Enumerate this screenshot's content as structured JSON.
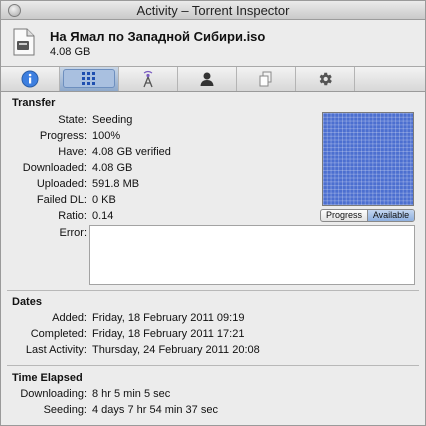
{
  "window": {
    "title": "Activity – Torrent Inspector"
  },
  "torrent": {
    "name": "На Ямал по Западной Сибири.iso",
    "size": "4.08 GB"
  },
  "tabs": [
    {
      "id": "info",
      "icon": "info-icon"
    },
    {
      "id": "activity",
      "icon": "pieces-grid-icon",
      "selected": true
    },
    {
      "id": "trackers",
      "icon": "antenna-icon"
    },
    {
      "id": "peers",
      "icon": "person-icon"
    },
    {
      "id": "files",
      "icon": "documents-icon"
    },
    {
      "id": "options",
      "icon": "gear-icon"
    }
  ],
  "transfer": {
    "title": "Transfer",
    "rows": [
      {
        "label": "State:",
        "value": "Seeding"
      },
      {
        "label": "Progress:",
        "value": "100%"
      },
      {
        "label": "Have:",
        "value": "4.08 GB verified"
      },
      {
        "label": "Downloaded:",
        "value": "4.08 GB"
      },
      {
        "label": "Uploaded:",
        "value": "591.8 MB"
      },
      {
        "label": "Failed DL:",
        "value": "0 KB"
      },
      {
        "label": "Ratio:",
        "value": "0.14"
      },
      {
        "label": "Error:",
        "value": ""
      }
    ],
    "pieces_toggle": {
      "progress": "Progress",
      "available": "Available",
      "selected": "available"
    }
  },
  "dates": {
    "title": "Dates",
    "rows": [
      {
        "label": "Added:",
        "value": "Friday, 18 February 2011 09:19"
      },
      {
        "label": "Completed:",
        "value": "Friday, 18 February 2011 17:21"
      },
      {
        "label": "Last Activity:",
        "value": "Thursday, 24 February 2011 20:08"
      }
    ]
  },
  "time_elapsed": {
    "title": "Time Elapsed",
    "rows": [
      {
        "label": "Downloading:",
        "value": "8 hr 5 min 5 sec"
      },
      {
        "label": "Seeding:",
        "value": "4 days 7 hr 54 min 37 sec"
      }
    ]
  },
  "colors": {
    "pieces_fill": "#4c6fd0",
    "tab_selected": "#8ea9cc"
  }
}
